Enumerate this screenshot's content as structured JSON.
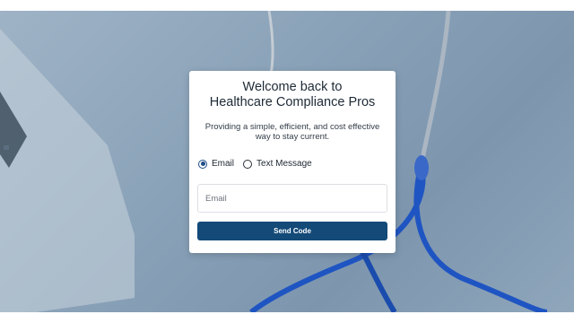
{
  "login": {
    "title_line1": "Welcome back to",
    "title_line2": "Healthcare Compliance Pros",
    "subtitle": "Providing a simple, efficient, and cost effective way to stay current.",
    "options": [
      {
        "label": "Email",
        "selected": true
      },
      {
        "label": "Text Message",
        "selected": false
      }
    ],
    "email_placeholder": "Email",
    "email_value": "",
    "submit_label": "Send Code"
  },
  "colors": {
    "accent": "#134a78",
    "background": "#8aa2b8"
  }
}
